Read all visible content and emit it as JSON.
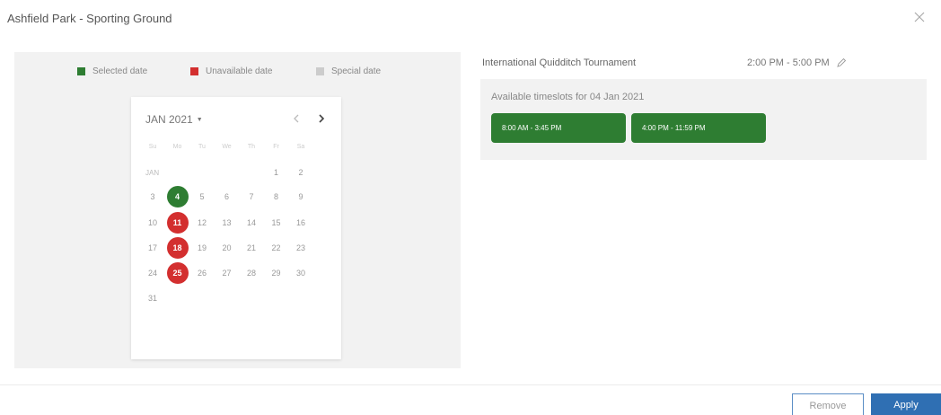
{
  "modal": {
    "title": "Ashfield Park - Sporting Ground"
  },
  "legend": [
    {
      "label": "Selected date",
      "color": "#2e7d32"
    },
    {
      "label": "Unavailable date",
      "color": "#d32f2f"
    },
    {
      "label": "Special date",
      "color": "#cccccc"
    }
  ],
  "calendar": {
    "month_label": "JAN 2021",
    "weekdays": [
      "Su",
      "Mo",
      "Tu",
      "We",
      "Th",
      "Fr",
      "Sa"
    ],
    "month_short": "JAN",
    "days": [
      "1",
      "2",
      "3",
      "4",
      "5",
      "6",
      "7",
      "8",
      "9",
      "10",
      "11",
      "12",
      "13",
      "14",
      "15",
      "16",
      "17",
      "18",
      "19",
      "20",
      "21",
      "22",
      "23",
      "24",
      "25",
      "26",
      "27",
      "28",
      "29",
      "30",
      "31"
    ],
    "selected_day": "4",
    "unavailable_days": [
      "11",
      "18",
      "25"
    ]
  },
  "event": {
    "name": "International Quidditch Tournament",
    "time": "2:00 PM - 5:00 PM"
  },
  "slots": {
    "heading": "Available timeslots for 04 Jan 2021",
    "items": [
      "8:00 AM - 3:45 PM",
      "4:00 PM - 11:59 PM"
    ]
  },
  "footer": {
    "remove_label": "Remove",
    "apply_label": "Apply"
  },
  "colors": {
    "selected": "#2e7d32",
    "unavailable": "#d32f2f",
    "primary": "#2f6fb3"
  }
}
